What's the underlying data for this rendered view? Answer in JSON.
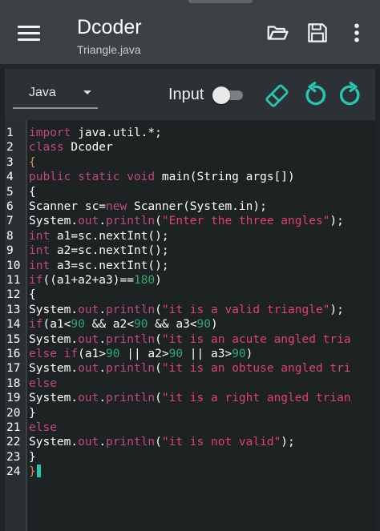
{
  "app": {
    "title": "Dcoder",
    "subtitle": "Triangle.java"
  },
  "toolbar": {
    "language": "Java",
    "input_label": "Input",
    "input_enabled": false
  },
  "icons": {
    "menu": "hamburger-menu-icon",
    "open": "folder-open-icon",
    "save": "save-icon",
    "more": "more-vert-icon",
    "eraser": "eraser-icon",
    "undo": "undo-icon",
    "redo": "redo-icon"
  },
  "colors": {
    "appbar": "#3b4144",
    "accent": "#26c6b3",
    "keyword": "#c2497e",
    "string": "#e0416f",
    "number": "#33a86f",
    "text": "#ffffff"
  },
  "editor": {
    "line_numbers": [
      "1",
      "2",
      "3",
      "4",
      "5",
      "6",
      "7",
      "8",
      "9",
      "10",
      "11",
      "12",
      "13",
      "14",
      "15",
      "16",
      "17",
      "18",
      "19",
      "20",
      "21",
      "22",
      "23",
      "24"
    ],
    "lines": [
      [
        [
          "kw",
          "import"
        ],
        [
          "tx",
          " java.util.*;"
        ]
      ],
      [
        [
          "kw",
          "class"
        ],
        [
          "tx",
          " Dcoder"
        ]
      ],
      [
        [
          "br",
          "{"
        ]
      ],
      [
        [
          "kw",
          "public static void"
        ],
        [
          "tx",
          " main(String args[])"
        ]
      ],
      [
        [
          "tx",
          "{"
        ]
      ],
      [
        [
          "tx",
          "Scanner sc="
        ],
        [
          "kw",
          "new"
        ],
        [
          "tx",
          " Scanner(System.in);"
        ]
      ],
      [
        [
          "tx",
          "System."
        ],
        [
          "kw",
          "out"
        ],
        [
          "tx",
          "."
        ],
        [
          "kw",
          "println"
        ],
        [
          "tx",
          "("
        ],
        [
          "st",
          "\"Enter the three angles\""
        ],
        [
          "tx",
          ");"
        ]
      ],
      [
        [
          "kw",
          "int"
        ],
        [
          "tx",
          " a1=sc.nextInt();"
        ]
      ],
      [
        [
          "kw",
          "int"
        ],
        [
          "tx",
          " a2=sc.nextInt();"
        ]
      ],
      [
        [
          "kw",
          "int"
        ],
        [
          "tx",
          " a3=sc.nextInt();"
        ]
      ],
      [
        [
          "kw",
          "if"
        ],
        [
          "tx",
          "((a1+a2+a3)=="
        ],
        [
          "nm",
          "180"
        ],
        [
          "tx",
          ")"
        ]
      ],
      [
        [
          "tx",
          "{"
        ]
      ],
      [
        [
          "tx",
          "System."
        ],
        [
          "kw",
          "out"
        ],
        [
          "tx",
          "."
        ],
        [
          "kw",
          "println"
        ],
        [
          "tx",
          "("
        ],
        [
          "st",
          "\"it is a valid triangle\""
        ],
        [
          "tx",
          ");"
        ]
      ],
      [
        [
          "kw",
          "if"
        ],
        [
          "tx",
          "(a1<"
        ],
        [
          "nm",
          "90"
        ],
        [
          "tx",
          " && a2<"
        ],
        [
          "nm",
          "90"
        ],
        [
          "tx",
          " && a3<"
        ],
        [
          "nm",
          "90"
        ],
        [
          "tx",
          ")"
        ]
      ],
      [
        [
          "tx",
          "System."
        ],
        [
          "kw",
          "out"
        ],
        [
          "tx",
          "."
        ],
        [
          "kw",
          "println"
        ],
        [
          "tx",
          "("
        ],
        [
          "st",
          "\"it is an acute angled tria"
        ]
      ],
      [
        [
          "kw",
          "else if"
        ],
        [
          "tx",
          "(a1>"
        ],
        [
          "nm",
          "90"
        ],
        [
          "tx",
          " || a2>"
        ],
        [
          "nm",
          "90"
        ],
        [
          "tx",
          " || a3>"
        ],
        [
          "nm",
          "90"
        ],
        [
          "tx",
          ")"
        ]
      ],
      [
        [
          "tx",
          "System."
        ],
        [
          "kw",
          "out"
        ],
        [
          "tx",
          "."
        ],
        [
          "kw",
          "println"
        ],
        [
          "tx",
          "("
        ],
        [
          "st",
          "\"it is an obtuse angled tri"
        ]
      ],
      [
        [
          "kw",
          "else"
        ]
      ],
      [
        [
          "tx",
          "System."
        ],
        [
          "kw",
          "out"
        ],
        [
          "tx",
          "."
        ],
        [
          "kw",
          "println"
        ],
        [
          "tx",
          "("
        ],
        [
          "st",
          "\"it is a right angled trian"
        ]
      ],
      [
        [
          "tx",
          "}"
        ]
      ],
      [
        [
          "kw",
          "else"
        ]
      ],
      [
        [
          "tx",
          "System."
        ],
        [
          "kw",
          "out"
        ],
        [
          "tx",
          "."
        ],
        [
          "kw",
          "println"
        ],
        [
          "tx",
          "("
        ],
        [
          "st",
          "\"it is not valid\""
        ],
        [
          "tx",
          ");"
        ]
      ],
      [
        [
          "tx",
          "}"
        ]
      ],
      [
        [
          "br",
          "}"
        ],
        [
          "cursor",
          ""
        ]
      ]
    ]
  }
}
